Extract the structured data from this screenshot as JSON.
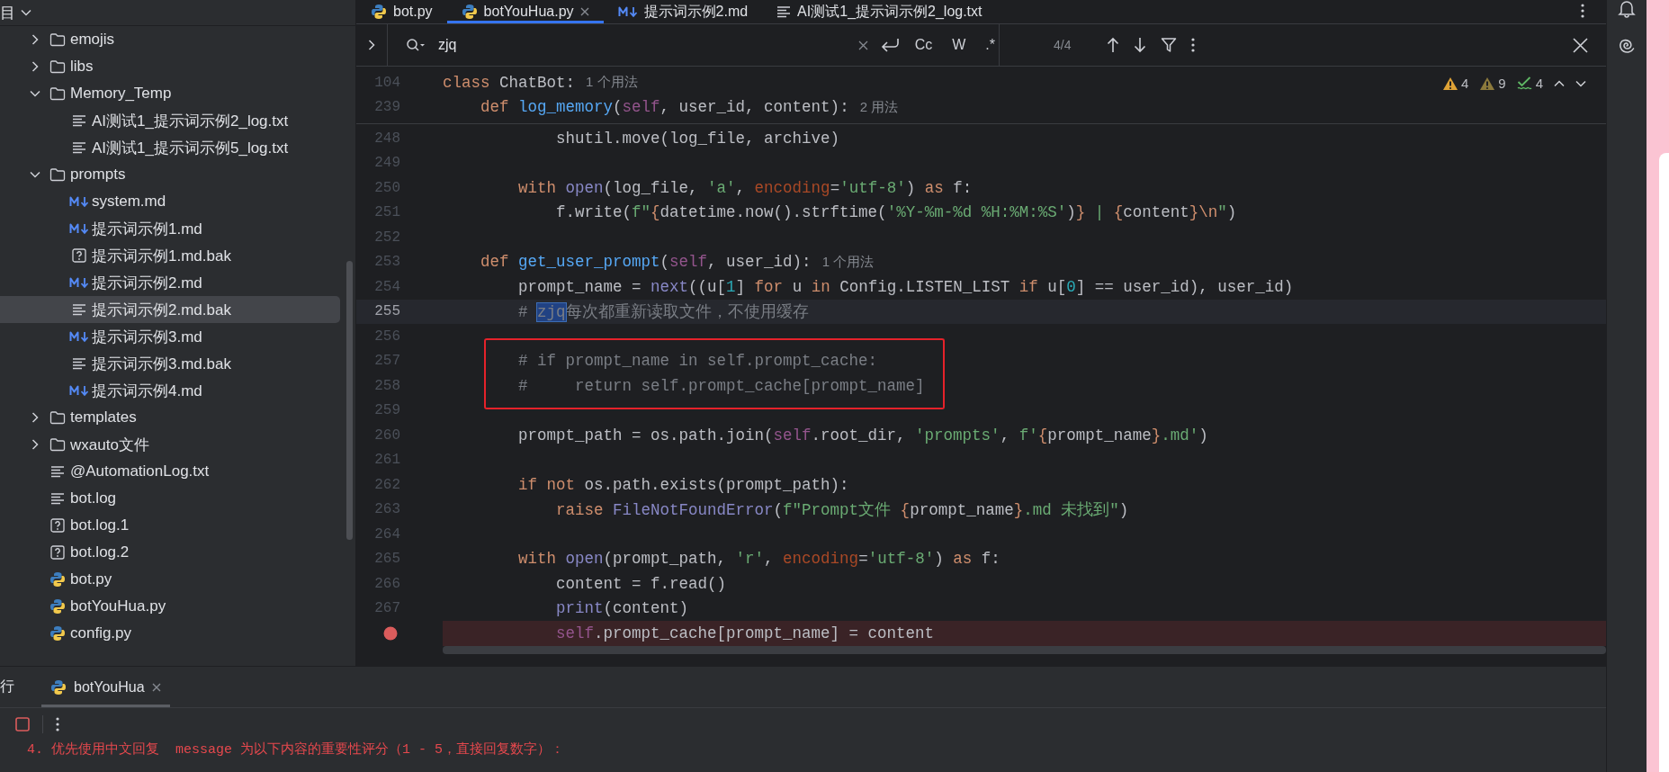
{
  "project": {
    "header": "目",
    "tree": [
      {
        "label": "emojis",
        "kind": "folder",
        "expanded": false,
        "selected": false
      },
      {
        "label": "libs",
        "kind": "folder",
        "expanded": false,
        "selected": false
      },
      {
        "label": "Memory_Temp",
        "kind": "folder",
        "expanded": true,
        "selected": false,
        "children": [
          {
            "label": "AI测试1_提示词示例2_log.txt",
            "kind": "text",
            "selected": false
          },
          {
            "label": "AI测试1_提示词示例5_log.txt",
            "kind": "text",
            "selected": false
          }
        ]
      },
      {
        "label": "prompts",
        "kind": "folder",
        "expanded": true,
        "selected": false,
        "children": [
          {
            "label": "system.md",
            "kind": "md",
            "selected": false
          },
          {
            "label": "提示词示例1.md",
            "kind": "md",
            "selected": false
          },
          {
            "label": "提示词示例1.md.bak",
            "kind": "unknown",
            "selected": false
          },
          {
            "label": "提示词示例2.md",
            "kind": "md",
            "selected": false
          },
          {
            "label": "提示词示例2.md.bak",
            "kind": "text",
            "selected": true
          },
          {
            "label": "提示词示例3.md",
            "kind": "md",
            "selected": false
          },
          {
            "label": "提示词示例3.md.bak",
            "kind": "text",
            "selected": false
          },
          {
            "label": "提示词示例4.md",
            "kind": "md",
            "selected": false
          }
        ]
      },
      {
        "label": "templates",
        "kind": "folder",
        "expanded": false,
        "selected": false
      },
      {
        "label": "wxauto文件",
        "kind": "folder",
        "expanded": false,
        "selected": false
      },
      {
        "label": "@AutomationLog.txt",
        "kind": "text",
        "selected": false
      },
      {
        "label": "bot.log",
        "kind": "text",
        "selected": false
      },
      {
        "label": "bot.log.1",
        "kind": "unknown",
        "selected": false
      },
      {
        "label": "bot.log.2",
        "kind": "unknown",
        "selected": false
      },
      {
        "label": "bot.py",
        "kind": "python",
        "selected": false
      },
      {
        "label": "botYouHua.py",
        "kind": "python",
        "selected": false
      },
      {
        "label": "config.py",
        "kind": "python",
        "selected": false
      }
    ]
  },
  "editor_tabs": [
    {
      "label": "bot.py",
      "kind": "python",
      "selected": false,
      "closable": false
    },
    {
      "label": "botYouHua.py",
      "kind": "python",
      "selected": true,
      "closable": true
    },
    {
      "label": "提示词示例2.md",
      "kind": "md",
      "selected": false,
      "closable": false
    },
    {
      "label": "AI测试1_提示词示例2_log.txt",
      "kind": "text",
      "selected": false,
      "closable": false
    }
  ],
  "find_bar": {
    "query": "zjq",
    "options": [
      {
        "label": "Cc",
        "selected": false
      },
      {
        "label": "W",
        "selected": false
      },
      {
        "label": ".*",
        "selected": false
      }
    ],
    "match_count": "4/4"
  },
  "inspections": [
    {
      "kind": "warning",
      "count": "4"
    },
    {
      "kind": "weak_warning",
      "count": "9"
    },
    {
      "kind": "typo",
      "count": "4"
    }
  ],
  "sticky_lines": [
    {
      "number": "104",
      "tokens": [
        {
          "kind": "keyword",
          "text": "class"
        },
        {
          "kind": "plain",
          "text": " ChatBot:"
        }
      ],
      "hint": "1 个用法"
    },
    {
      "number": "239",
      "tokens": [
        {
          "kind": "keyword",
          "text": "    def "
        },
        {
          "kind": "function",
          "text": "log_memory"
        },
        {
          "kind": "plain",
          "text": "("
        },
        {
          "kind": "self",
          "text": "self"
        },
        {
          "kind": "plain",
          "text": ", user_id, content):"
        }
      ],
      "hint": "2 用法"
    }
  ],
  "lines": [
    {
      "number": "248",
      "kind": "plain",
      "boxed": false,
      "tokens": [
        {
          "kind": "plain",
          "text": "            shutil.move(log_file, archive)"
        }
      ]
    },
    {
      "number": "249",
      "kind": "plain",
      "boxed": false
    },
    {
      "number": "250",
      "kind": "plain",
      "boxed": false,
      "tokens": [
        {
          "kind": "keyword",
          "text": "        with "
        },
        {
          "kind": "builtin",
          "text": "open"
        },
        {
          "kind": "plain",
          "text": "(log_file, "
        },
        {
          "kind": "string",
          "text": "'a'"
        },
        {
          "kind": "plain",
          "text": ", "
        },
        {
          "kind": "param",
          "text": "encoding"
        },
        {
          "kind": "plain",
          "text": "="
        },
        {
          "kind": "string",
          "text": "'utf-8'"
        },
        {
          "kind": "plain",
          "text": ") "
        },
        {
          "kind": "keyword",
          "text": "as"
        },
        {
          "kind": "plain",
          "text": " f:"
        }
      ]
    },
    {
      "number": "251",
      "kind": "plain",
      "boxed": false,
      "tokens": [
        {
          "kind": "plain",
          "text": "            f.write("
        },
        {
          "kind": "string",
          "text": "f\""
        },
        {
          "kind": "keyword",
          "text": "{"
        },
        {
          "kind": "plain",
          "text": "datetime.now().strftime("
        },
        {
          "kind": "string",
          "text": "'%Y-%m-%d %H:%M:%S'"
        },
        {
          "kind": "plain",
          "text": ")"
        },
        {
          "kind": "keyword",
          "text": "}"
        },
        {
          "kind": "string",
          "text": " | "
        },
        {
          "kind": "keyword",
          "text": "{"
        },
        {
          "kind": "plain",
          "text": "content"
        },
        {
          "kind": "keyword",
          "text": "}\\n"
        },
        {
          "kind": "string",
          "text": "\""
        },
        {
          "kind": "plain",
          "text": ")"
        }
      ]
    },
    {
      "number": "252",
      "kind": "plain",
      "boxed": false
    },
    {
      "number": "253",
      "kind": "plain",
      "boxed": false,
      "tokens": [
        {
          "kind": "keyword",
          "text": "    def "
        },
        {
          "kind": "function",
          "text": "get_user_prompt"
        },
        {
          "kind": "plain",
          "text": "("
        },
        {
          "kind": "self",
          "text": "self"
        },
        {
          "kind": "plain",
          "text": ", user_id):"
        }
      ],
      "hint": "1 个用法"
    },
    {
      "number": "254",
      "kind": "plain",
      "boxed": false,
      "tokens": [
        {
          "kind": "plain",
          "text": "        prompt_name = "
        },
        {
          "kind": "builtin",
          "text": "next"
        },
        {
          "kind": "plain",
          "text": "((u["
        },
        {
          "kind": "number",
          "text": "1"
        },
        {
          "kind": "plain",
          "text": "] "
        },
        {
          "kind": "keyword",
          "text": "for"
        },
        {
          "kind": "plain",
          "text": " u "
        },
        {
          "kind": "keyword",
          "text": "in"
        },
        {
          "kind": "plain",
          "text": " Config.LISTEN_LIST "
        },
        {
          "kind": "keyword",
          "text": "if"
        },
        {
          "kind": "plain",
          "text": " u["
        },
        {
          "kind": "number",
          "text": "0"
        },
        {
          "kind": "plain",
          "text": "] == user_id), user_id)"
        }
      ]
    },
    {
      "number": "255",
      "kind": "current",
      "boxed": false,
      "tokens": [
        {
          "kind": "comment",
          "text": "        # "
        },
        {
          "kind": "match",
          "text": "zjq"
        },
        {
          "kind": "comment",
          "text": "每次都重新读取文件，不使用缓存"
        }
      ]
    },
    {
      "number": "256",
      "kind": "plain",
      "boxed": false
    },
    {
      "number": "257",
      "kind": "plain",
      "boxed": true,
      "tokens": [
        {
          "kind": "comment",
          "text": "        # if prompt_name in self.prompt_cache:"
        }
      ]
    },
    {
      "number": "258",
      "kind": "plain",
      "boxed": true,
      "tokens": [
        {
          "kind": "comment",
          "text": "        #     return self.prompt_cache[prompt_name]"
        }
      ]
    },
    {
      "number": "259",
      "kind": "plain",
      "boxed": false
    },
    {
      "number": "260",
      "kind": "plain",
      "boxed": false,
      "tokens": [
        {
          "kind": "plain",
          "text": "        prompt_path = os.path.join("
        },
        {
          "kind": "self",
          "text": "self"
        },
        {
          "kind": "plain",
          "text": ".root_dir, "
        },
        {
          "kind": "string",
          "text": "'prompts'"
        },
        {
          "kind": "plain",
          "text": ", "
        },
        {
          "kind": "string",
          "text": "f'"
        },
        {
          "kind": "keyword",
          "text": "{"
        },
        {
          "kind": "plain",
          "text": "prompt_name"
        },
        {
          "kind": "keyword",
          "text": "}"
        },
        {
          "kind": "string",
          "text": ".md'"
        },
        {
          "kind": "plain",
          "text": ")"
        }
      ]
    },
    {
      "number": "261",
      "kind": "plain",
      "boxed": false
    },
    {
      "number": "262",
      "kind": "plain",
      "boxed": false,
      "tokens": [
        {
          "kind": "keyword",
          "text": "        if not"
        },
        {
          "kind": "plain",
          "text": " os.path.exists(prompt_path):"
        }
      ]
    },
    {
      "number": "263",
      "kind": "plain",
      "boxed": false,
      "tokens": [
        {
          "kind": "keyword",
          "text": "            raise "
        },
        {
          "kind": "builtin",
          "text": "FileNotFoundError"
        },
        {
          "kind": "plain",
          "text": "("
        },
        {
          "kind": "string",
          "text": "f\"Prompt文件 "
        },
        {
          "kind": "keyword",
          "text": "{"
        },
        {
          "kind": "plain",
          "text": "prompt_name"
        },
        {
          "kind": "keyword",
          "text": "}"
        },
        {
          "kind": "string",
          "text": ".md 未找到\""
        },
        {
          "kind": "plain",
          "text": ")"
        }
      ]
    },
    {
      "number": "264",
      "kind": "plain",
      "boxed": false
    },
    {
      "number": "265",
      "kind": "plain",
      "boxed": false,
      "tokens": [
        {
          "kind": "keyword",
          "text": "        with "
        },
        {
          "kind": "builtin",
          "text": "open"
        },
        {
          "kind": "plain",
          "text": "(prompt_path, "
        },
        {
          "kind": "string",
          "text": "'r'"
        },
        {
          "kind": "plain",
          "text": ", "
        },
        {
          "kind": "param",
          "text": "encoding"
        },
        {
          "kind": "plain",
          "text": "="
        },
        {
          "kind": "string",
          "text": "'utf-8'"
        },
        {
          "kind": "plain",
          "text": ") "
        },
        {
          "kind": "keyword",
          "text": "as"
        },
        {
          "kind": "plain",
          "text": " f:"
        }
      ]
    },
    {
      "number": "266",
      "kind": "plain",
      "boxed": false,
      "tokens": [
        {
          "kind": "plain",
          "text": "            content = f.read()"
        }
      ]
    },
    {
      "number": "267",
      "kind": "plain",
      "boxed": false,
      "tokens": [
        {
          "kind": "builtin",
          "text": "            print"
        },
        {
          "kind": "plain",
          "text": "(content)"
        }
      ]
    },
    {
      "kind": "breakpoint",
      "boxed": false,
      "tokens": [
        {
          "kind": "self",
          "text": "            self"
        },
        {
          "kind": "plain",
          "text": ".prompt_cache[prompt_name] = content"
        }
      ]
    }
  ],
  "run_panel": {
    "partial_label": "行",
    "tab": {
      "label": "botYouHua",
      "selected": true
    },
    "console": [
      {
        "kind": "error",
        "text": "4. 优先使用中文回复  message 为以下内容的重要性评分（1 - 5，直接回复数字）："
      }
    ]
  }
}
